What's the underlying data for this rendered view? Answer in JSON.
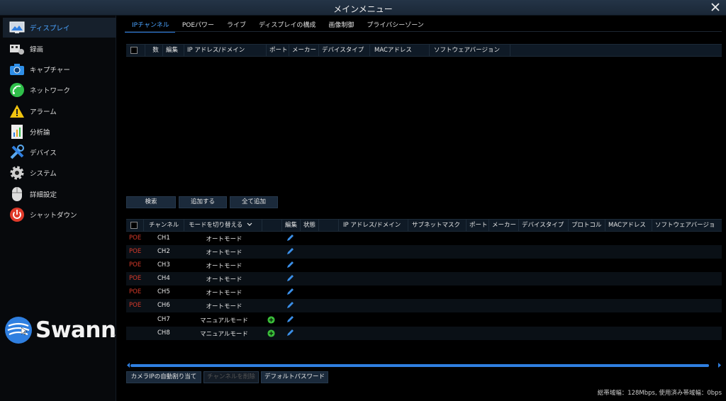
{
  "window": {
    "title": "メインメニュー"
  },
  "sidebar": {
    "items": [
      {
        "label": "ディスプレイ",
        "icon": "display-icon",
        "active": true
      },
      {
        "label": "録画",
        "icon": "record-icon"
      },
      {
        "label": "キャプチャー",
        "icon": "camera-icon"
      },
      {
        "label": "ネットワーク",
        "icon": "network-icon"
      },
      {
        "label": "アラーム",
        "icon": "alarm-icon"
      },
      {
        "label": "分析論",
        "icon": "analytics-icon"
      },
      {
        "label": "デバイス",
        "icon": "device-icon"
      },
      {
        "label": "システム",
        "icon": "gear-icon"
      },
      {
        "label": "詳細設定",
        "icon": "mouse-icon"
      },
      {
        "label": "シャットダウン",
        "icon": "power-icon"
      }
    ],
    "logo": {
      "text": "Swann",
      "mark": "™"
    }
  },
  "tabs": [
    "IPチャンネル",
    "POEパワー",
    "ライブ",
    "ディスプレイの構成",
    "画像制御",
    "プライバシーゾーン"
  ],
  "search_table": {
    "headers": [
      "数",
      "編集",
      "IP アドレス/ドメイン",
      "ポート",
      "メーカー",
      "デバイスタイプ",
      "MACアドレス",
      "ソフトウェアバージョン"
    ]
  },
  "buttons": {
    "search": "検索",
    "add": "追加する",
    "add_all": "全て追加"
  },
  "channel_table": {
    "headers": [
      "チャンネル",
      "モードを切り替える",
      "編集",
      "状態",
      "IP アドレス/ドメイン",
      "サブネットマスク",
      "ポート",
      "メーカー",
      "デバイスタイプ",
      "プロトコル",
      "MACアドレス",
      "ソフトウェアバージョ"
    ],
    "rows": [
      {
        "poe": "POE",
        "channel": "CH1",
        "mode": "オートモード"
      },
      {
        "poe": "POE",
        "channel": "CH2",
        "mode": "オートモード"
      },
      {
        "poe": "POE",
        "channel": "CH3",
        "mode": "オートモード"
      },
      {
        "poe": "POE",
        "channel": "CH4",
        "mode": "オートモード"
      },
      {
        "poe": "POE",
        "channel": "CH5",
        "mode": "オートモード"
      },
      {
        "poe": "POE",
        "channel": "CH6",
        "mode": "オートモード"
      },
      {
        "poe": "",
        "channel": "CH7",
        "mode": "マニュアルモード"
      },
      {
        "poe": "",
        "channel": "CH8",
        "mode": "マニュアルモード"
      }
    ]
  },
  "bottom_buttons": {
    "auto_assign": "カメラIPの自動割り当て",
    "delete_channel": "チャンネルを削除",
    "default_password": "デフォルトパスワード"
  },
  "status": {
    "bandwidth": "総帯域幅：128Mbps, 使用済み帯域幅：0bps"
  },
  "colors": {
    "accent": "#2f7fe0",
    "poe": "#d93a2a"
  }
}
